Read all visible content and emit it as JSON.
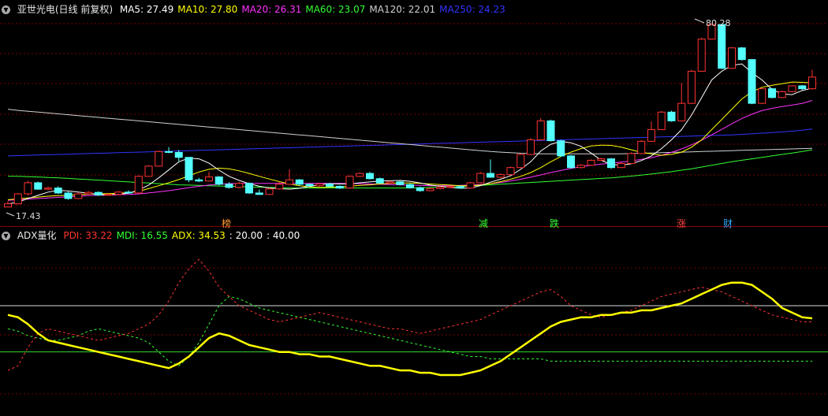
{
  "main_header": {
    "title": "亚世光电(日线 前复权)",
    "indicators": [
      {
        "label": "MA5: 27.49",
        "color": "#ffffff"
      },
      {
        "label": "MA10: 27.80",
        "color": "#ffff00"
      },
      {
        "label": "MA20: 26.31",
        "color": "#ff33ff"
      },
      {
        "label": "MA60: 23.07",
        "color": "#33ff33"
      },
      {
        "label": "MA120: 22.01",
        "color": "#d0d0d0"
      },
      {
        "label": "MA250: 24.23",
        "color": "#3333ff"
      }
    ]
  },
  "price_labels": {
    "high": "80.28",
    "low": "17.43"
  },
  "event_tags": [
    {
      "text": "榜",
      "color": "#ff9933"
    },
    {
      "text": "减",
      "color": "#33ff33"
    },
    {
      "text": "跌",
      "color": "#33ff33"
    },
    {
      "text": "涨",
      "color": "#ff4444"
    },
    {
      "text": "财",
      "color": "#33aaff"
    }
  ],
  "sub_header": {
    "title": "ADX量化",
    "indicators": [
      {
        "label": "PDI: 33.22",
        "color": "#ff3333"
      },
      {
        "label": "MDI: 16.55",
        "color": "#33ff33"
      },
      {
        "label": "ADX: 34.53",
        "color": "#ffff00"
      },
      {
        "label": ": 20.00",
        "color": "#ffffff"
      },
      {
        "label": ": 40.00",
        "color": "#ffffff"
      }
    ]
  },
  "candles": [
    [
      17.5,
      18.6,
      19.5,
      17.4
    ],
    [
      18.6,
      22.0,
      22.3,
      18.4
    ],
    [
      22.0,
      25.8,
      26.5,
      21.5
    ],
    [
      25.8,
      23.6,
      26.2,
      23.4
    ],
    [
      23.6,
      24.0,
      24.5,
      23.2
    ],
    [
      24.0,
      22.3,
      24.6,
      21.9
    ],
    [
      22.3,
      20.4,
      22.8,
      20.0
    ],
    [
      20.4,
      22.0,
      22.6,
      20.2
    ],
    [
      22.0,
      22.5,
      23.0,
      21.7
    ],
    [
      22.5,
      21.6,
      22.9,
      21.3
    ],
    [
      21.6,
      21.8,
      22.3,
      21.4
    ],
    [
      21.8,
      22.6,
      23.0,
      21.6
    ],
    [
      22.6,
      22.3,
      23.2,
      22.0
    ],
    [
      22.3,
      28.0,
      28.3,
      22.1
    ],
    [
      28.0,
      31.5,
      31.8,
      27.9
    ],
    [
      31.5,
      36.5,
      36.8,
      31.3
    ],
    [
      36.5,
      36.2,
      38.0,
      35.9
    ],
    [
      36.2,
      34.5,
      37.0,
      33.2
    ],
    [
      34.5,
      26.8,
      27.3,
      26.0
    ],
    [
      26.8,
      26.4,
      27.5,
      26.0
    ],
    [
      26.4,
      27.8,
      29.6,
      26.2
    ],
    [
      27.8,
      25.3,
      28.1,
      24.9
    ],
    [
      25.3,
      24.2,
      26.0,
      23.8
    ],
    [
      24.2,
      25.6,
      26.1,
      23.9
    ],
    [
      25.6,
      22.3,
      25.9,
      22.0
    ],
    [
      22.3,
      21.8,
      23.5,
      21.6
    ],
    [
      21.8,
      23.7,
      24.2,
      21.6
    ],
    [
      23.7,
      25.3,
      26.2,
      23.4
    ],
    [
      25.3,
      26.8,
      30.4,
      25.1
    ],
    [
      26.8,
      25.3,
      27.1,
      24.8
    ],
    [
      25.3,
      24.8,
      25.6,
      24.4
    ],
    [
      24.8,
      25.4,
      25.7,
      24.4
    ],
    [
      25.4,
      24.6,
      25.8,
      24.3
    ],
    [
      24.6,
      24.0,
      24.9,
      23.7
    ],
    [
      24.0,
      28.0,
      28.3,
      23.8
    ],
    [
      28.0,
      29.0,
      29.3,
      27.8
    ],
    [
      29.0,
      27.2,
      29.5,
      26.9
    ],
    [
      27.2,
      25.7,
      27.6,
      25.4
    ],
    [
      25.7,
      26.1,
      26.5,
      25.5
    ],
    [
      26.1,
      25.2,
      26.4,
      24.9
    ],
    [
      25.2,
      24.1,
      25.7,
      23.8
    ],
    [
      24.1,
      23.1,
      24.5,
      22.7
    ],
    [
      23.1,
      23.8,
      24.2,
      22.9
    ],
    [
      23.8,
      24.3,
      24.7,
      23.6
    ],
    [
      24.3,
      24.5,
      24.8,
      23.9
    ],
    [
      24.5,
      24.0,
      24.8,
      23.8
    ],
    [
      24.0,
      25.8,
      26.2,
      23.8
    ],
    [
      25.8,
      29.0,
      29.5,
      25.6
    ],
    [
      29.0,
      27.7,
      33.8,
      27.5
    ],
    [
      27.7,
      28.6,
      29.0,
      27.4
    ],
    [
      28.6,
      31.0,
      31.4,
      28.4
    ],
    [
      31.0,
      35.5,
      35.8,
      30.8
    ],
    [
      35.5,
      40.5,
      41.1,
      35.3
    ],
    [
      40.5,
      47.0,
      48.0,
      40.3
    ],
    [
      47.0,
      40.2,
      47.4,
      39.9
    ],
    [
      40.2,
      35.0,
      40.5,
      34.7
    ],
    [
      35.0,
      31.0,
      35.3,
      30.6
    ],
    [
      31.0,
      31.8,
      32.2,
      30.7
    ],
    [
      31.8,
      33.5,
      33.8,
      31.6
    ],
    [
      33.5,
      34.0,
      34.4,
      33.3
    ],
    [
      34.0,
      31.0,
      34.3,
      30.6
    ],
    [
      31.0,
      32.4,
      32.8,
      30.9
    ],
    [
      32.4,
      35.8,
      36.2,
      32.2
    ],
    [
      35.8,
      40.0,
      40.4,
      35.6
    ],
    [
      40.0,
      44.0,
      46.8,
      39.8
    ],
    [
      44.0,
      50.0,
      50.4,
      43.9
    ],
    [
      50.0,
      47.0,
      50.5,
      46.7
    ],
    [
      47.0,
      53.0,
      60.0,
      46.8
    ],
    [
      53.0,
      64.0,
      64.5,
      52.8
    ],
    [
      64.0,
      75.0,
      75.5,
      63.8
    ],
    [
      75.0,
      80.0,
      80.3,
      74.8
    ],
    [
      80.0,
      65.0,
      80.1,
      64.7
    ],
    [
      65.0,
      72.0,
      72.3,
      64.8
    ],
    [
      72.0,
      68.0,
      72.3,
      67.6
    ],
    [
      68.0,
      53.0,
      68.2,
      52.7
    ],
    [
      53.0,
      58.0,
      58.4,
      52.8
    ],
    [
      58.0,
      55.0,
      58.2,
      54.7
    ],
    [
      55.0,
      57.0,
      57.4,
      54.9
    ],
    [
      57.0,
      59.0,
      59.2,
      56.8
    ],
    [
      59.0,
      58.0,
      59.3,
      57.6
    ],
    [
      58.0,
      62.0,
      64.5,
      57.7
    ]
  ],
  "ma_lines": {
    "ma5": {
      "color": "#ffffff",
      "values": [
        18.5,
        19.2,
        20.4,
        21.5,
        22.6,
        23.2,
        23.0,
        22.6,
        22.2,
        21.8,
        21.7,
        21.9,
        22.2,
        23.3,
        25.0,
        27.5,
        30.2,
        33.0,
        34.2,
        34.0,
        32.5,
        30.1,
        28.0,
        26.6,
        25.5,
        24.6,
        24.0,
        23.8,
        23.6,
        23.9,
        24.5,
        25.2,
        25.5,
        25.4,
        25.4,
        25.8,
        26.1,
        26.4,
        26.5,
        26.6,
        26.3,
        25.7,
        25.0,
        24.6,
        24.2,
        23.9,
        24.0,
        24.8,
        26.0,
        27.0,
        28.2,
        30.4,
        33.0,
        36.7,
        39.0,
        40.0,
        39.5,
        38.3,
        36.0,
        33.5,
        32.1,
        31.8,
        32.3,
        33.4,
        35.0,
        37.5,
        40.5,
        44.0,
        49.0,
        55.0,
        61.0,
        64.0,
        66.0,
        66.5,
        63.5,
        61.0,
        57.8,
        56.2,
        56.0,
        57.4,
        58.2
      ]
    },
    "ma10": {
      "color": "#ffff00",
      "values": [
        20.0,
        20.3,
        20.6,
        20.9,
        21.2,
        21.4,
        21.5,
        21.7,
        21.9,
        22.0,
        22.1,
        22.2,
        22.4,
        22.9,
        23.8,
        24.8,
        25.8,
        26.9,
        28.2,
        29.5,
        30.4,
        30.8,
        30.6,
        29.9,
        29.0,
        28.0,
        27.1,
        26.2,
        25.4,
        24.8,
        24.4,
        24.2,
        24.3,
        24.4,
        24.6,
        24.9,
        25.1,
        25.4,
        25.6,
        25.7,
        25.7,
        25.6,
        25.4,
        25.2,
        25.0,
        24.8,
        24.8,
        25.0,
        25.5,
        26.2,
        27.0,
        28.0,
        29.3,
        31.0,
        33.0,
        34.8,
        36.3,
        37.5,
        38.4,
        38.7,
        38.6,
        38.0,
        37.1,
        36.2,
        35.7,
        35.2,
        35.5,
        36.3,
        38.0,
        40.5,
        44.0,
        47.5,
        51.0,
        54.5,
        57.0,
        58.5,
        59.2,
        59.7,
        60.3,
        60.2,
        60.0
      ]
    },
    "ma20": {
      "color": "#ff33ff",
      "values": [
        19.8,
        20.0,
        20.2,
        20.4,
        20.6,
        20.8,
        21.0,
        21.2,
        21.4,
        21.5,
        21.6,
        21.7,
        21.8,
        22.0,
        22.3,
        22.7,
        23.1,
        23.6,
        24.1,
        24.6,
        25.0,
        25.3,
        25.5,
        25.6,
        25.6,
        25.6,
        25.6,
        25.6,
        25.6,
        25.6,
        25.6,
        25.6,
        25.6,
        25.6,
        25.5,
        25.5,
        25.4,
        25.3,
        25.2,
        25.1,
        25.0,
        24.9,
        24.8,
        24.8,
        24.8,
        24.9,
        25.0,
        25.2,
        25.5,
        25.9,
        26.4,
        27.0,
        27.7,
        28.5,
        29.3,
        30.0,
        30.7,
        31.3,
        31.8,
        32.2,
        32.5,
        32.9,
        33.3,
        33.8,
        34.4,
        35.2,
        36.2,
        37.4,
        38.8,
        40.4,
        42.2,
        44.1,
        46.0,
        47.8,
        49.3,
        50.5,
        51.3,
        51.9,
        52.4,
        53.0,
        54.0
      ]
    },
    "ma60": {
      "color": "#33ff33",
      "values": [
        28.0,
        28.0,
        27.9,
        27.8,
        27.6,
        27.5,
        27.3,
        27.1,
        26.9,
        26.7,
        26.5,
        26.3,
        26.1,
        25.9,
        25.7,
        25.5,
        25.3,
        25.1,
        25.0,
        24.9,
        24.8,
        24.7,
        24.6,
        24.5,
        24.4,
        24.3,
        24.2,
        24.1,
        24.0,
        24.0,
        24.0,
        24.0,
        24.0,
        24.0,
        24.0,
        24.0,
        24.0,
        24.0,
        24.0,
        24.0,
        24.0,
        24.1,
        24.2,
        24.3,
        24.4,
        24.5,
        24.7,
        24.9,
        25.1,
        25.3,
        25.5,
        25.7,
        25.9,
        26.1,
        26.3,
        26.5,
        26.7,
        26.9,
        27.1,
        27.3,
        27.5,
        27.8,
        28.1,
        28.4,
        28.8,
        29.2,
        29.6,
        30.1,
        30.6,
        31.2,
        31.8,
        32.4,
        33.0,
        33.5,
        34.0,
        34.5,
        35.0,
        35.5,
        36.0,
        36.5,
        37.1
      ]
    },
    "ma120": {
      "color": "#d0d0d0",
      "values": [
        51.0,
        50.6,
        50.3,
        50.0,
        49.7,
        49.4,
        49.1,
        48.8,
        48.5,
        48.2,
        47.9,
        47.6,
        47.3,
        47.0,
        46.7,
        46.4,
        46.1,
        45.8,
        45.5,
        45.2,
        44.9,
        44.6,
        44.3,
        44.0,
        43.7,
        43.4,
        43.1,
        42.8,
        42.5,
        42.2,
        41.9,
        41.6,
        41.3,
        41.0,
        40.7,
        40.4,
        40.1,
        39.8,
        39.5,
        39.2,
        38.9,
        38.6,
        38.3,
        38.0,
        37.7,
        37.4,
        37.1,
        36.8,
        36.5,
        36.3,
        36.1,
        35.9,
        35.8,
        35.7,
        35.7,
        35.7,
        35.7,
        35.7,
        35.7,
        35.7,
        35.7,
        35.7,
        35.8,
        35.9,
        36.0,
        36.1,
        36.2,
        36.3,
        36.4,
        36.5,
        36.6,
        36.7,
        36.8,
        36.9,
        37.0,
        37.1,
        37.2,
        37.3,
        37.4,
        37.5,
        37.6
      ]
    },
    "ma250": {
      "color": "#3333ff",
      "values": [
        35.0,
        35.1,
        35.2,
        35.3,
        35.4,
        35.5,
        35.6,
        35.7,
        35.8,
        35.9,
        36.0,
        36.1,
        36.2,
        36.3,
        36.4,
        36.5,
        36.6,
        36.7,
        36.8,
        36.9,
        37.0,
        37.1,
        37.2,
        37.3,
        37.4,
        37.5,
        37.6,
        37.7,
        37.8,
        37.9,
        38.0,
        38.1,
        38.2,
        38.3,
        38.4,
        38.5,
        38.6,
        38.7,
        38.8,
        38.9,
        39.0,
        39.1,
        39.2,
        39.3,
        39.4,
        39.5,
        39.6,
        39.7,
        39.8,
        39.9,
        40.0,
        40.1,
        40.2,
        40.3,
        40.4,
        40.5,
        40.6,
        40.7,
        40.8,
        40.9,
        41.0,
        41.1,
        41.2,
        41.3,
        41.4,
        41.5,
        41.6,
        41.7,
        41.8,
        41.9,
        42.0,
        42.1,
        42.2,
        42.4,
        42.6,
        42.8,
        43.0,
        43.2,
        43.5,
        43.8,
        44.2
      ]
    }
  },
  "adx_lines": {
    "pdi": {
      "color": "#ff3333",
      "values": [
        12,
        14,
        22,
        28,
        30,
        29,
        28,
        27,
        26,
        25,
        26,
        27,
        28,
        30,
        32,
        36,
        42,
        50,
        56,
        60,
        55,
        48,
        44,
        40,
        38,
        36,
        34,
        33,
        34,
        35,
        36,
        37,
        36,
        35,
        34,
        33,
        32,
        31,
        30,
        30,
        29,
        28,
        29,
        30,
        31,
        32,
        33,
        34,
        36,
        38,
        40,
        42,
        44,
        46,
        47,
        44,
        40,
        38,
        36,
        35,
        36,
        37,
        38,
        40,
        42,
        44,
        45,
        46,
        47,
        48,
        47,
        46,
        44,
        42,
        40,
        38,
        36,
        35,
        34,
        33,
        33
      ]
    },
    "mdi": {
      "color": "#33ff33",
      "values": [
        30,
        29,
        27,
        26,
        25,
        25,
        26,
        27,
        29,
        30,
        29,
        28,
        27,
        26,
        24,
        20,
        16,
        14,
        18,
        24,
        32,
        40,
        44,
        43,
        41,
        39,
        38,
        37,
        36,
        35,
        34,
        33,
        32,
        31,
        30,
        29,
        28,
        27,
        26,
        25,
        24,
        23,
        22,
        21,
        20,
        19,
        18,
        18,
        17,
        17,
        17,
        17,
        17,
        17,
        16,
        16,
        16,
        16,
        16,
        16,
        16,
        16,
        16,
        16,
        16,
        16,
        16,
        16,
        16,
        16,
        16,
        16,
        16,
        16,
        16,
        16,
        16,
        16,
        16,
        16,
        16
      ]
    },
    "adx": {
      "color": "#ffff00",
      "values": [
        36,
        35,
        32,
        28,
        25,
        24,
        23,
        22,
        21,
        20,
        19,
        18,
        17,
        16,
        15,
        14,
        13,
        15,
        18,
        22,
        26,
        28,
        27,
        25,
        23,
        22,
        21,
        20,
        20,
        19,
        19,
        18,
        18,
        17,
        16,
        15,
        14,
        14,
        13,
        12,
        12,
        11,
        11,
        10,
        10,
        10,
        11,
        12,
        14,
        16,
        19,
        22,
        25,
        28,
        31,
        33,
        34,
        35,
        35,
        36,
        36,
        37,
        37,
        38,
        38,
        39,
        40,
        41,
        43,
        45,
        47,
        49,
        50,
        50,
        49,
        46,
        43,
        39,
        37,
        35,
        34.53
      ]
    },
    "level20": 20,
    "level40": 40
  }
}
